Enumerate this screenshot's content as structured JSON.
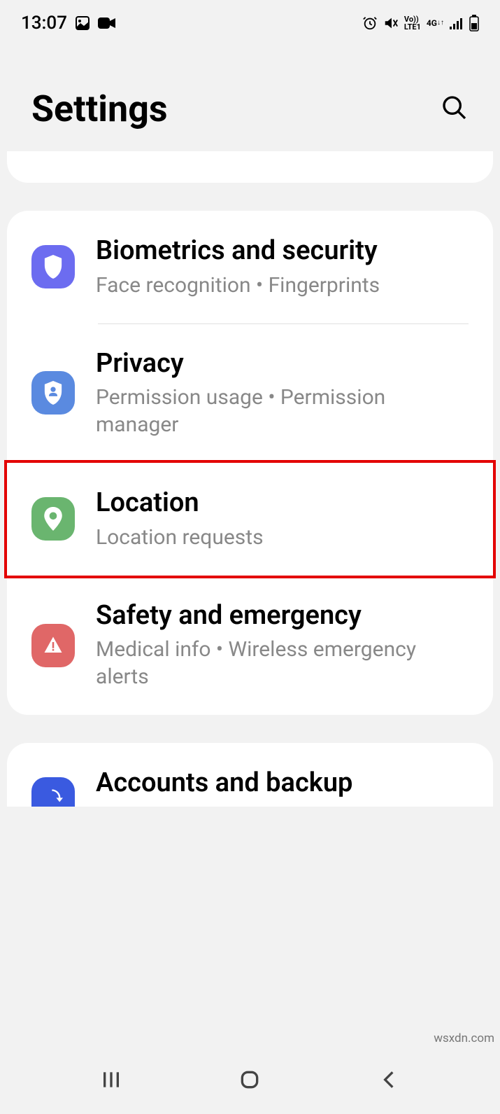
{
  "status_bar": {
    "time": "13:07",
    "network_label": "Vo))\nLTE1",
    "signal": "4G"
  },
  "header": {
    "title": "Settings"
  },
  "items": [
    {
      "title": "Biometrics and security",
      "subtitle": "Face recognition  •  Fingerprints",
      "icon": "shield",
      "color": "purple"
    },
    {
      "title": "Privacy",
      "subtitle": "Permission usage  •  Permission manager",
      "icon": "shield-person",
      "color": "blue"
    },
    {
      "title": "Location",
      "subtitle": "Location requests",
      "icon": "pin",
      "color": "green",
      "highlighted": true
    },
    {
      "title": "Safety and emergency",
      "subtitle": "Medical info  •  Wireless emergency alerts",
      "icon": "alert",
      "color": "red"
    }
  ],
  "next_section": {
    "title": "Accounts and backup",
    "icon": "sync",
    "color": "darkblue"
  },
  "watermark": "wsxdn.com"
}
